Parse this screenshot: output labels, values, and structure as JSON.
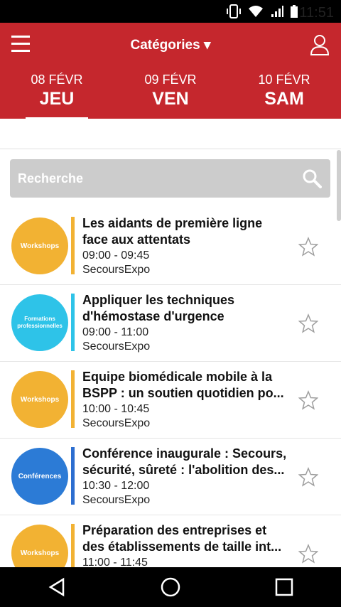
{
  "status_bar": {
    "time": "11:51"
  },
  "header": {
    "categories_label": "Catégories ▾"
  },
  "days": [
    {
      "date": "08 FÉVR",
      "weekday": "JEU",
      "selected": true
    },
    {
      "date": "09 FÉVR",
      "weekday": "VEN",
      "selected": false
    },
    {
      "date": "10 FÉVR",
      "weekday": "SAM",
      "selected": false
    }
  ],
  "search": {
    "placeholder": "Recherche"
  },
  "sessions": [
    {
      "category": "Workshops",
      "color": "#f2b233",
      "bar_color": "#f2b233",
      "title": "Les aidants de première ligne face aux attentats",
      "time": "09:00 - 09:45",
      "place": "SecoursExpo"
    },
    {
      "category": "Formations professionnelles",
      "color": "#2ec3e8",
      "bar_color": "#2ec3e8",
      "title": "Appliquer les techniques d'hémostase d'urgence",
      "time": "09:00 - 11:00",
      "place": "SecoursExpo"
    },
    {
      "category": "Workshops",
      "color": "#f2b233",
      "bar_color": "#f2b233",
      "title": "Equipe biomédicale mobile à la BSPP : un soutien quotidien po...",
      "time": "10:00 - 10:45",
      "place": "SecoursExpo"
    },
    {
      "category": "Conférences",
      "color": "#2c7bd6",
      "bar_color": "#2c6ed0",
      "title": "Conférence inaugurale : Secours, sécurité, sûreté : l'abolition des...",
      "time": "10:30 - 12:00",
      "place": "SecoursExpo"
    },
    {
      "category": "Workshops",
      "color": "#f2b233",
      "bar_color": "#f2b233",
      "title": "Préparation des entreprises et des établissements de taille int...",
      "time": "11:00 - 11:45",
      "place": ""
    }
  ]
}
